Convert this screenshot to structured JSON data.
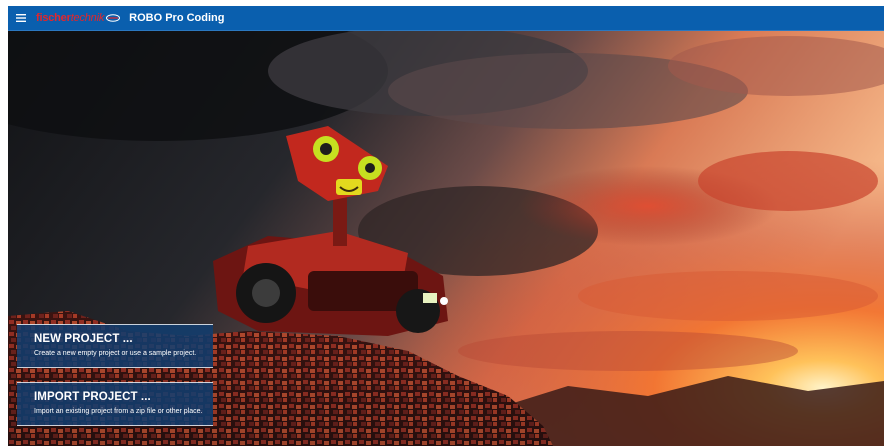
{
  "app": {
    "logo_part1": "fischer",
    "logo_part2": "technik",
    "title": "ROBO Pro Coding"
  },
  "icons": {
    "menu": "hamburger-menu-icon",
    "logo_mark": "fischertechnik-logo-mark"
  },
  "actions": [
    {
      "title": "NEW PROJECT ...",
      "description": "Create a new empty project or use a sample project."
    },
    {
      "title": "IMPORT PROJECT ...",
      "description": "Import an existing project from a zip file or other place."
    }
  ],
  "colors": {
    "appbar": "#0a5fae",
    "logo_red": "#e3262b",
    "card_bg": "#123e70"
  }
}
